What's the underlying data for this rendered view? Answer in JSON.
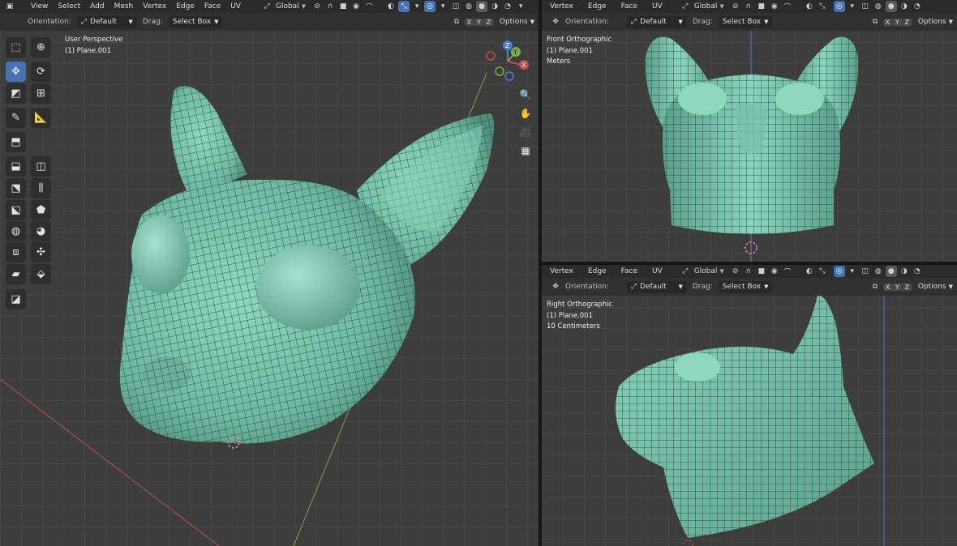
{
  "main_view": {
    "menus": [
      "View",
      "Select",
      "Add",
      "Mesh",
      "Vertex",
      "Edge",
      "Face",
      "UV"
    ],
    "transform_orientation": "Global",
    "orientation_label": "Orientation:",
    "orientation_value": "Default",
    "drag_label": "Drag:",
    "drag_value": "Select Box",
    "axes": [
      "X",
      "Y",
      "Z"
    ],
    "options_label": "Options",
    "overlay_line1": "User Perspective",
    "overlay_line2": "(1) Plane.001"
  },
  "front_view": {
    "menus": [
      "Vertex",
      "Edge",
      "Face",
      "UV"
    ],
    "transform_orientation": "Global",
    "orientation_label": "Orientation:",
    "orientation_value": "Default",
    "drag_label": "Drag:",
    "drag_value": "Select Box",
    "axes": [
      "X",
      "Y",
      "Z"
    ],
    "options_label": "Options",
    "overlay_line1": "Front Orthographic",
    "overlay_line2": "(1) Plane.001",
    "overlay_line3": "Meters"
  },
  "right_view": {
    "menus": [
      "Vertex",
      "Edge",
      "Face",
      "UV"
    ],
    "transform_orientation": "Global",
    "orientation_label": "Orientation:",
    "orientation_value": "Default",
    "drag_label": "Drag:",
    "drag_value": "Select Box",
    "axes": [
      "X",
      "Y",
      "Z"
    ],
    "options_label": "Options",
    "overlay_line1": "Right Orthographic",
    "overlay_line2": "(1) Plane.001",
    "overlay_line3": "10 Centimeters"
  },
  "gizmo": {
    "x": "X",
    "y": "Y",
    "z": "Z"
  },
  "colors": {
    "mesh": "#7cc8b0",
    "wire": "#1e3a33",
    "x_axis": "#c0504d",
    "y_axis": "#7f9f3a",
    "active": "#4772b3"
  },
  "toolbar_icons": [
    "select-box",
    "cursor",
    "move",
    "rotate",
    "scale",
    "transform",
    "annotate",
    "measure",
    "add-cube",
    "extrude",
    "inset",
    "bevel",
    "loop-cut",
    "knife",
    "poly-build",
    "spin",
    "smooth",
    "edge-slide",
    "shrink-fatten",
    "shear",
    "rip-region"
  ]
}
